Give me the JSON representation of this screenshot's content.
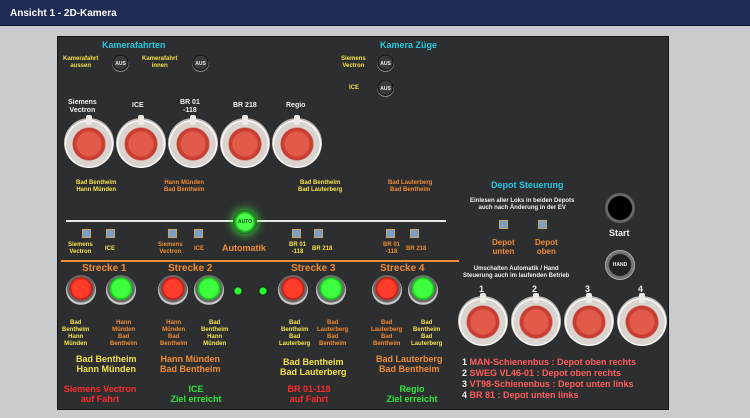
{
  "window": {
    "title": "Ansicht 1 - 2D-Kamera"
  },
  "section_titles": {
    "kamerafahrten": "Kamerafahrten",
    "kamera_zuege": "Kamera Züge",
    "depot_steuerung": "Depot Steuerung",
    "automatik": "Automatik"
  },
  "toggles": {
    "aus_label": "AUS",
    "auto_label": "AUTO",
    "hand_label": "HAND",
    "kamerafahrt_aussen": "Kamerafahrt\naussen",
    "kamerafahrt_innen": "Kamerafahrt\ninnen",
    "siemens_vectron": "Siemens\nVectron",
    "ice": "ICE"
  },
  "knobs": {
    "labels": [
      "Siemens\nVectron",
      "ICE",
      "BR 01\n-118",
      "BR 218",
      "Regio"
    ],
    "route_labels": [
      {
        "text": "Bad Bentheim\nHann Münden",
        "color": "yellow"
      },
      {
        "text": "Hann Münden\nBad Bentheim",
        "color": "orange"
      },
      {
        "text": "Bad Bentheim\nBad Lauterberg",
        "color": "yellow"
      },
      {
        "text": "Bad Lauterberg\nBad Bentheim",
        "color": "orange"
      }
    ]
  },
  "checkboxes": {
    "g1": [
      "Siemens\nVectron",
      "ICE"
    ],
    "g2": [
      "Siemens\nVectron",
      "ICE"
    ],
    "g3": [
      "BR 01\n-118",
      "BR 218"
    ],
    "g4": [
      "BR 01\n-118",
      "BR 218"
    ]
  },
  "strecken": [
    {
      "title": "Strecke 1",
      "red_label": "Bad\nBentheim\nHann\nMünden",
      "green_label": "Hann\nMünden\nBad\nBentheim",
      "route": "Bad Bentheim\nHann Münden",
      "status_line1": "Siemens Vectron",
      "status_line2": "auf Fahrt",
      "status_color": "red"
    },
    {
      "title": "Strecke 2",
      "red_label": "Hann\nMünden\nBad\nBentheim",
      "green_label": "Bad\nBentheim\nHann\nMünden",
      "route": "Hann Münden\nBad Bentheim",
      "status_line1": "ICE",
      "status_line2": "Ziel erreicht",
      "status_color": "green"
    },
    {
      "title": "Strecke 3",
      "red_label": "Bad\nBentheim\nBad\nLauterberg",
      "green_label": "Bad\nLauterberg\nBad\nBentheim",
      "route": "Bad Bentheim\nBad Lauterberg",
      "status_line1": "BR 01-118",
      "status_line2": "auf Fahrt",
      "status_color": "red"
    },
    {
      "title": "Strecke 4",
      "red_label": "Bad\nLauterberg\nBad\nBentheim",
      "green_label": "Bad\nBentheim\nBad\nLauterberg",
      "route": "Bad Lauterberg\nBad Bentheim",
      "status_line1": "Regio",
      "status_line2": "Ziel erreicht",
      "status_color": "green"
    }
  ],
  "depot": {
    "einlesen": "Einlesen aller Loks in beiden Depots\nauch nach Änderung in der EV",
    "depot_unten": "Depot\nunten",
    "depot_oben": "Depot\noben",
    "start": "Start",
    "umschalten": "Umschalten Automatik / Hand\nSteuerung auch im laufenden Betrieb",
    "knob_numbers": [
      "1",
      "2",
      "3",
      "4"
    ],
    "list": [
      {
        "n": "1",
        "text": "MAN-Schienenbus : Depot oben rechts"
      },
      {
        "n": "2",
        "text": "SWEG VL46-01 : Depot oben rechts"
      },
      {
        "n": "3",
        "text": "VT98-Schienenbus  : Depot unten links"
      },
      {
        "n": "4",
        "text": "BR 81 : Depot unten links"
      }
    ]
  },
  "colors": {
    "background": "#2d2e2f",
    "cyan": "#22c8e0",
    "yellow": "#f2e14a",
    "orange": "#f08c32",
    "red": "#ff2a2a",
    "green": "#2fe63a"
  }
}
